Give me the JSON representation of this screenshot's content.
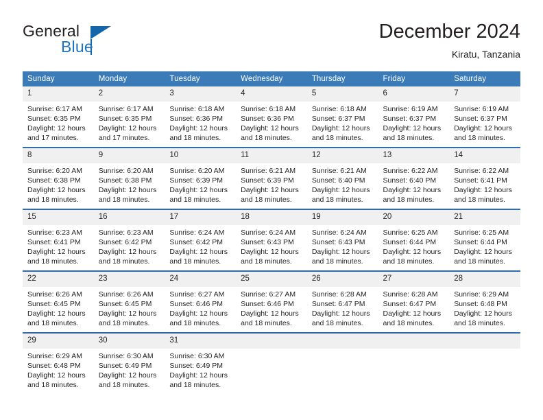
{
  "brand": {
    "name_part1": "General",
    "name_part2": "Blue",
    "logo_icon": "blue-triangle-logo"
  },
  "header": {
    "month_title": "December 2024",
    "location": "Kiratu, Tanzania"
  },
  "colors": {
    "header_blue": "#3b7cb8",
    "row_border_blue": "#2f6ca8",
    "daynum_gray": "#f0f0f0",
    "brand_blue": "#1e73be",
    "text": "#231f20"
  },
  "weekday_headers": [
    "Sunday",
    "Monday",
    "Tuesday",
    "Wednesday",
    "Thursday",
    "Friday",
    "Saturday"
  ],
  "weeks": [
    [
      {
        "day": "1",
        "sunrise": "Sunrise: 6:17 AM",
        "sunset": "Sunset: 6:35 PM",
        "daylight": "Daylight: 12 hours and 17 minutes."
      },
      {
        "day": "2",
        "sunrise": "Sunrise: 6:17 AM",
        "sunset": "Sunset: 6:35 PM",
        "daylight": "Daylight: 12 hours and 17 minutes."
      },
      {
        "day": "3",
        "sunrise": "Sunrise: 6:18 AM",
        "sunset": "Sunset: 6:36 PM",
        "daylight": "Daylight: 12 hours and 18 minutes."
      },
      {
        "day": "4",
        "sunrise": "Sunrise: 6:18 AM",
        "sunset": "Sunset: 6:36 PM",
        "daylight": "Daylight: 12 hours and 18 minutes."
      },
      {
        "day": "5",
        "sunrise": "Sunrise: 6:18 AM",
        "sunset": "Sunset: 6:37 PM",
        "daylight": "Daylight: 12 hours and 18 minutes."
      },
      {
        "day": "6",
        "sunrise": "Sunrise: 6:19 AM",
        "sunset": "Sunset: 6:37 PM",
        "daylight": "Daylight: 12 hours and 18 minutes."
      },
      {
        "day": "7",
        "sunrise": "Sunrise: 6:19 AM",
        "sunset": "Sunset: 6:37 PM",
        "daylight": "Daylight: 12 hours and 18 minutes."
      }
    ],
    [
      {
        "day": "8",
        "sunrise": "Sunrise: 6:20 AM",
        "sunset": "Sunset: 6:38 PM",
        "daylight": "Daylight: 12 hours and 18 minutes."
      },
      {
        "day": "9",
        "sunrise": "Sunrise: 6:20 AM",
        "sunset": "Sunset: 6:38 PM",
        "daylight": "Daylight: 12 hours and 18 minutes."
      },
      {
        "day": "10",
        "sunrise": "Sunrise: 6:20 AM",
        "sunset": "Sunset: 6:39 PM",
        "daylight": "Daylight: 12 hours and 18 minutes."
      },
      {
        "day": "11",
        "sunrise": "Sunrise: 6:21 AM",
        "sunset": "Sunset: 6:39 PM",
        "daylight": "Daylight: 12 hours and 18 minutes."
      },
      {
        "day": "12",
        "sunrise": "Sunrise: 6:21 AM",
        "sunset": "Sunset: 6:40 PM",
        "daylight": "Daylight: 12 hours and 18 minutes."
      },
      {
        "day": "13",
        "sunrise": "Sunrise: 6:22 AM",
        "sunset": "Sunset: 6:40 PM",
        "daylight": "Daylight: 12 hours and 18 minutes."
      },
      {
        "day": "14",
        "sunrise": "Sunrise: 6:22 AM",
        "sunset": "Sunset: 6:41 PM",
        "daylight": "Daylight: 12 hours and 18 minutes."
      }
    ],
    [
      {
        "day": "15",
        "sunrise": "Sunrise: 6:23 AM",
        "sunset": "Sunset: 6:41 PM",
        "daylight": "Daylight: 12 hours and 18 minutes."
      },
      {
        "day": "16",
        "sunrise": "Sunrise: 6:23 AM",
        "sunset": "Sunset: 6:42 PM",
        "daylight": "Daylight: 12 hours and 18 minutes."
      },
      {
        "day": "17",
        "sunrise": "Sunrise: 6:24 AM",
        "sunset": "Sunset: 6:42 PM",
        "daylight": "Daylight: 12 hours and 18 minutes."
      },
      {
        "day": "18",
        "sunrise": "Sunrise: 6:24 AM",
        "sunset": "Sunset: 6:43 PM",
        "daylight": "Daylight: 12 hours and 18 minutes."
      },
      {
        "day": "19",
        "sunrise": "Sunrise: 6:24 AM",
        "sunset": "Sunset: 6:43 PM",
        "daylight": "Daylight: 12 hours and 18 minutes."
      },
      {
        "day": "20",
        "sunrise": "Sunrise: 6:25 AM",
        "sunset": "Sunset: 6:44 PM",
        "daylight": "Daylight: 12 hours and 18 minutes."
      },
      {
        "day": "21",
        "sunrise": "Sunrise: 6:25 AM",
        "sunset": "Sunset: 6:44 PM",
        "daylight": "Daylight: 12 hours and 18 minutes."
      }
    ],
    [
      {
        "day": "22",
        "sunrise": "Sunrise: 6:26 AM",
        "sunset": "Sunset: 6:45 PM",
        "daylight": "Daylight: 12 hours and 18 minutes."
      },
      {
        "day": "23",
        "sunrise": "Sunrise: 6:26 AM",
        "sunset": "Sunset: 6:45 PM",
        "daylight": "Daylight: 12 hours and 18 minutes."
      },
      {
        "day": "24",
        "sunrise": "Sunrise: 6:27 AM",
        "sunset": "Sunset: 6:46 PM",
        "daylight": "Daylight: 12 hours and 18 minutes."
      },
      {
        "day": "25",
        "sunrise": "Sunrise: 6:27 AM",
        "sunset": "Sunset: 6:46 PM",
        "daylight": "Daylight: 12 hours and 18 minutes."
      },
      {
        "day": "26",
        "sunrise": "Sunrise: 6:28 AM",
        "sunset": "Sunset: 6:47 PM",
        "daylight": "Daylight: 12 hours and 18 minutes."
      },
      {
        "day": "27",
        "sunrise": "Sunrise: 6:28 AM",
        "sunset": "Sunset: 6:47 PM",
        "daylight": "Daylight: 12 hours and 18 minutes."
      },
      {
        "day": "28",
        "sunrise": "Sunrise: 6:29 AM",
        "sunset": "Sunset: 6:48 PM",
        "daylight": "Daylight: 12 hours and 18 minutes."
      }
    ],
    [
      {
        "day": "29",
        "sunrise": "Sunrise: 6:29 AM",
        "sunset": "Sunset: 6:48 PM",
        "daylight": "Daylight: 12 hours and 18 minutes."
      },
      {
        "day": "30",
        "sunrise": "Sunrise: 6:30 AM",
        "sunset": "Sunset: 6:49 PM",
        "daylight": "Daylight: 12 hours and 18 minutes."
      },
      {
        "day": "31",
        "sunrise": "Sunrise: 6:30 AM",
        "sunset": "Sunset: 6:49 PM",
        "daylight": "Daylight: 12 hours and 18 minutes."
      },
      {
        "day": "",
        "sunrise": "",
        "sunset": "",
        "daylight": ""
      },
      {
        "day": "",
        "sunrise": "",
        "sunset": "",
        "daylight": ""
      },
      {
        "day": "",
        "sunrise": "",
        "sunset": "",
        "daylight": ""
      },
      {
        "day": "",
        "sunrise": "",
        "sunset": "",
        "daylight": ""
      }
    ]
  ]
}
